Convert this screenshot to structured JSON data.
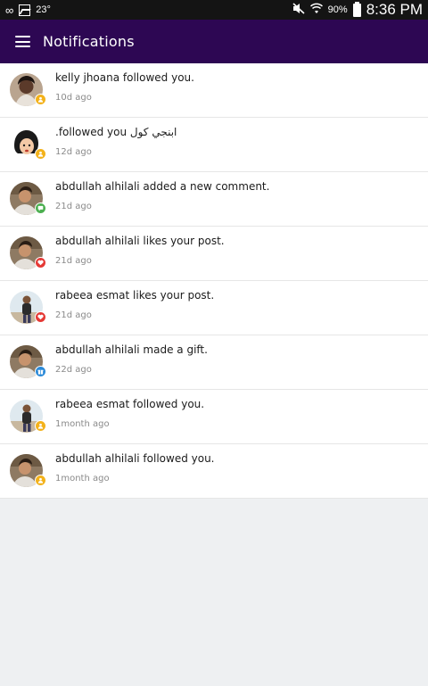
{
  "status_bar": {
    "temperature": "23°",
    "battery_percent": "90%",
    "time": "8:36 PM"
  },
  "toolbar": {
    "title": "Notifications"
  },
  "colors": {
    "toolbar": "#2d0753",
    "follow_badge": "#f3b21b",
    "comment_badge": "#4caf50",
    "like_badge": "#e53935",
    "gift_badge": "#2b8ad8"
  },
  "notifications": [
    {
      "text": "kelly jhoana followed you.",
      "time": "10d ago",
      "type": "follow",
      "avatar": "kelly"
    },
    {
      "text": ".followed you ابنجي كول",
      "time": "12d ago",
      "type": "follow",
      "avatar": "cartoon"
    },
    {
      "text": "abdullah alhilali added a new comment.",
      "time": "21d ago",
      "type": "comment",
      "avatar": "abdullah"
    },
    {
      "text": "abdullah alhilali likes your post.",
      "time": "21d ago",
      "type": "like",
      "avatar": "abdullah"
    },
    {
      "text": "rabeea esmat likes your post.",
      "time": "21d ago",
      "type": "like",
      "avatar": "rabeea"
    },
    {
      "text": "abdullah alhilali made a gift.",
      "time": "22d ago",
      "type": "gift",
      "avatar": "abdullah"
    },
    {
      "text": "rabeea esmat followed you.",
      "time": "1month ago",
      "type": "follow",
      "avatar": "rabeea"
    },
    {
      "text": "abdullah alhilali followed you.",
      "time": "1month ago",
      "type": "follow",
      "avatar": "abdullah"
    }
  ]
}
